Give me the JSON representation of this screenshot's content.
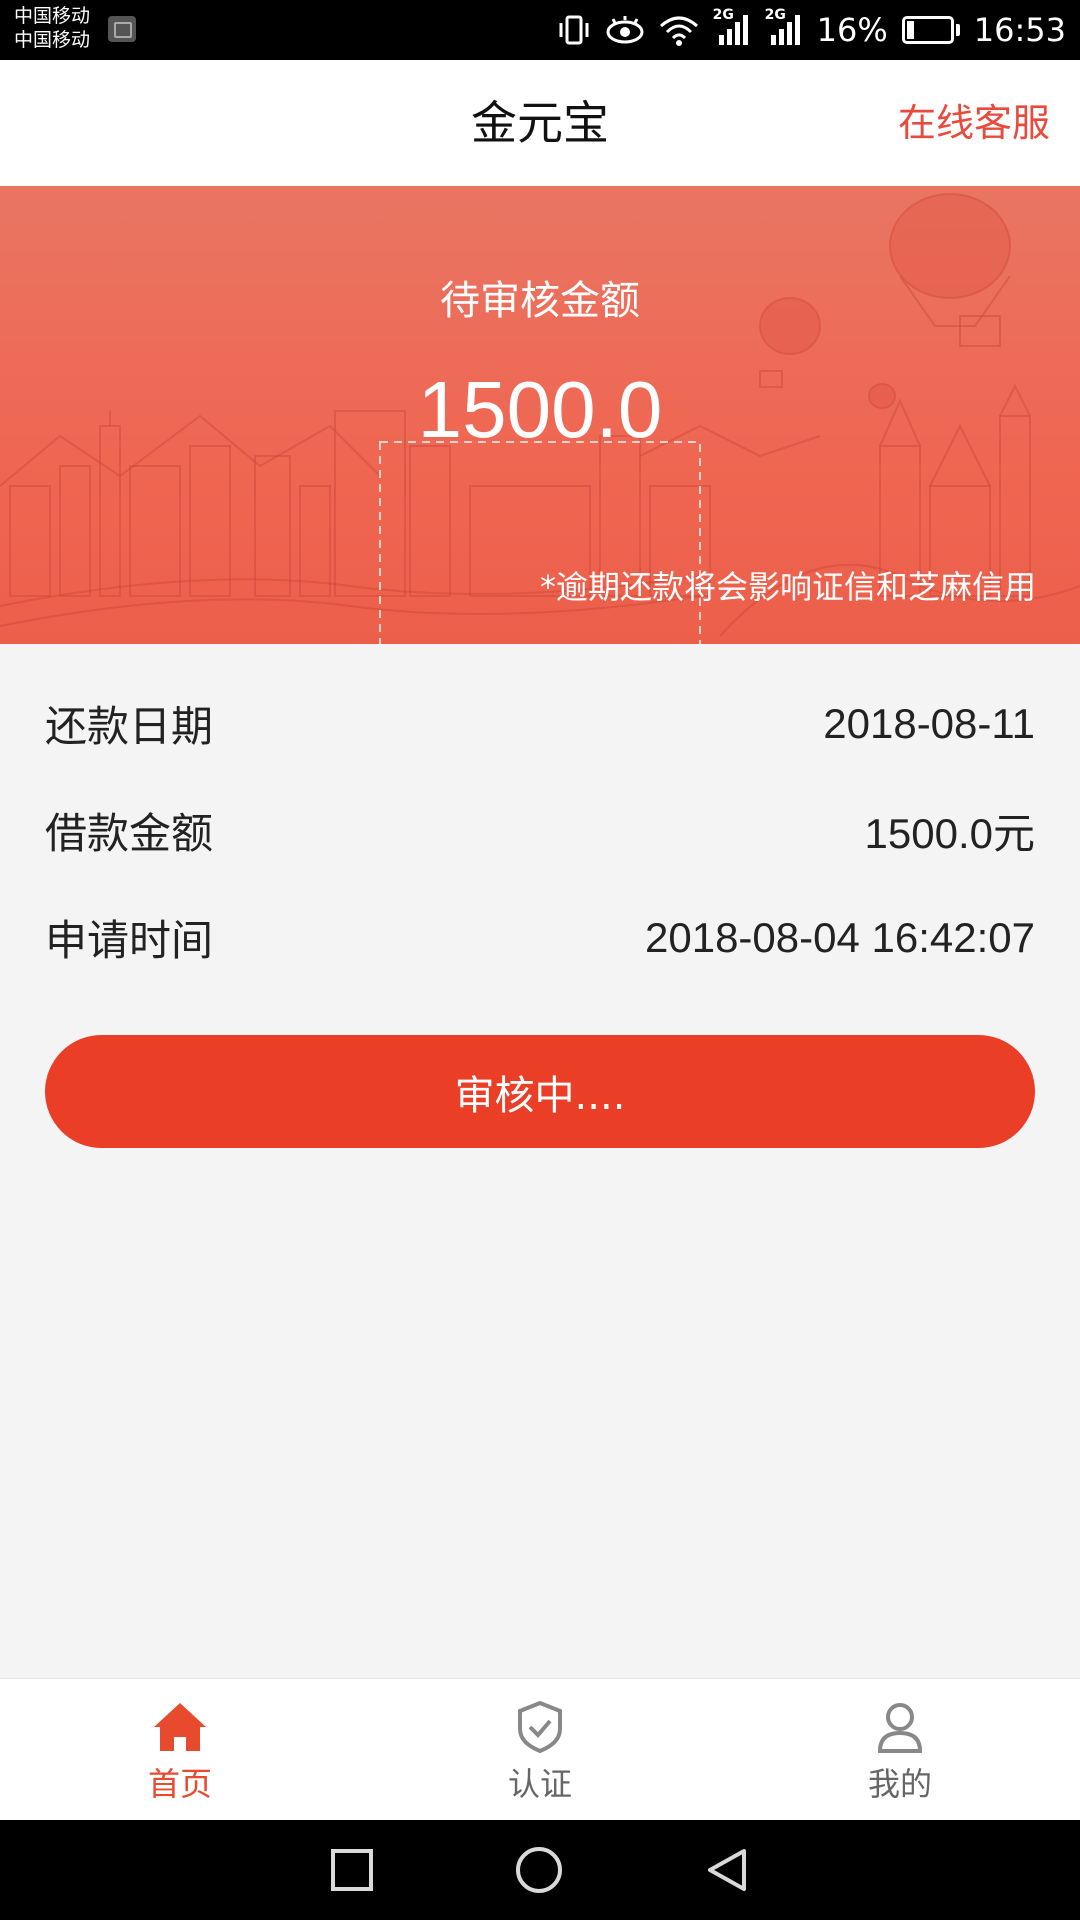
{
  "status_bar": {
    "carrier_1": "中国移动",
    "carrier_2": "中国移动",
    "network_1": "2G",
    "network_2": "2G",
    "battery": "16%",
    "time": "16:53",
    "icons": [
      "gallery-icon",
      "vibrate-icon",
      "eye-icon",
      "wifi-icon",
      "signal-icon",
      "signal-icon",
      "battery-icon"
    ]
  },
  "header": {
    "title": "金元宝",
    "service_link": "在线客服"
  },
  "banner": {
    "label": "待审核金额",
    "amount": "1500.0",
    "note": "*逾期还款将会影响证信和芝麻信用"
  },
  "info": {
    "rows": [
      {
        "label": "还款日期",
        "value": "2018-08-11"
      },
      {
        "label": "借款金额",
        "value": "1500.0元"
      },
      {
        "label": "申请时间",
        "value": "2018-08-04 16:42:07"
      }
    ]
  },
  "status_button": {
    "label": "审核中...."
  },
  "tabs": [
    {
      "label": "首页",
      "icon": "home-icon",
      "active": true
    },
    {
      "label": "认证",
      "icon": "shield-check-icon",
      "active": false
    },
    {
      "label": "我的",
      "icon": "user-icon",
      "active": false
    }
  ],
  "colors": {
    "accent": "#ea3e27",
    "banner": "#ef6651",
    "link": "#e84a3c"
  }
}
